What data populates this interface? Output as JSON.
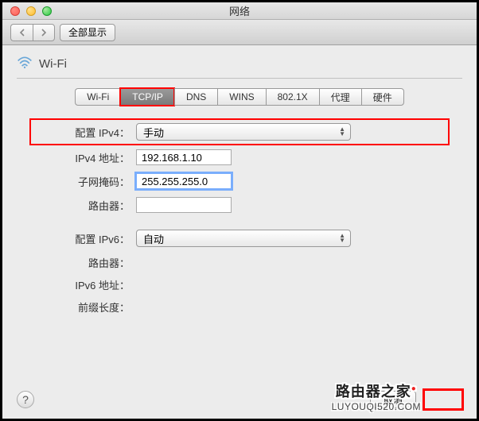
{
  "window": {
    "title": "网络"
  },
  "toolbar": {
    "show_all": "全部显示"
  },
  "panel": {
    "title": "Wi-Fi"
  },
  "tabs": [
    {
      "label": "Wi-Fi",
      "active": false
    },
    {
      "label": "TCP/IP",
      "active": true
    },
    {
      "label": "DNS",
      "active": false
    },
    {
      "label": "WINS",
      "active": false
    },
    {
      "label": "802.1X",
      "active": false
    },
    {
      "label": "代理",
      "active": false
    },
    {
      "label": "硬件",
      "active": false
    }
  ],
  "ipv4": {
    "config_label": "配置 IPv4：",
    "config_value": "手动",
    "address_label": "IPv4 地址：",
    "address_value": "192.168.1.10",
    "subnet_label": "子网掩码：",
    "subnet_value": "255.255.255.0",
    "router_label": "路由器：",
    "router_value": ""
  },
  "ipv6": {
    "config_label": "配置 IPv6：",
    "config_value": "自动",
    "router_label": "路由器：",
    "address_label": "IPv6 地址：",
    "prefix_label": "前缀长度："
  },
  "footer": {
    "cancel": "取消"
  },
  "watermark": {
    "line1": "路由器之家",
    "line2": "LUYOUQI520.COM"
  }
}
